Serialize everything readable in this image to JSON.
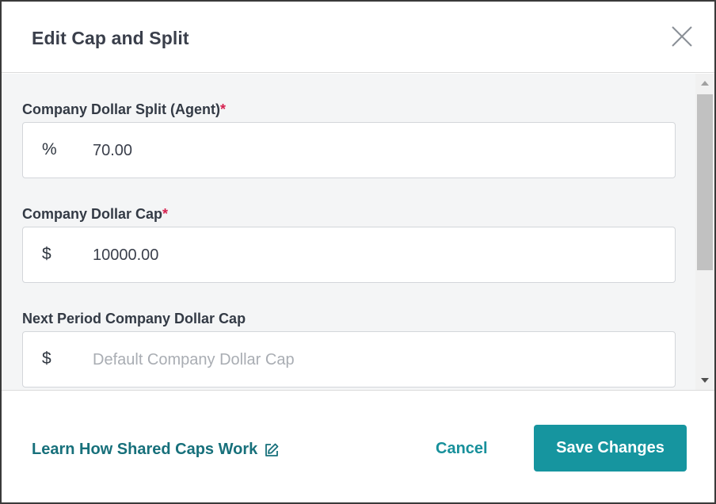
{
  "header": {
    "title": "Edit Cap and Split",
    "close_icon": "close-icon"
  },
  "fields": [
    {
      "label": "Company Dollar Split (Agent)",
      "required_mark": "*",
      "prefix": "%",
      "value": "70.00",
      "placeholder": ""
    },
    {
      "label": "Company Dollar Cap",
      "required_mark": "*",
      "prefix": "$",
      "value": "10000.00",
      "placeholder": ""
    },
    {
      "label": "Next Period Company Dollar Cap",
      "required_mark": "",
      "prefix": "$",
      "value": "",
      "placeholder": "Default Company Dollar Cap"
    }
  ],
  "footer": {
    "learn_link": "Learn How Shared Caps Work",
    "learn_icon": "edit-icon",
    "cancel_label": "Cancel",
    "save_label": "Save Changes"
  },
  "colors": {
    "accent": "#16959f",
    "link": "#17707b",
    "required": "#d6214f"
  }
}
